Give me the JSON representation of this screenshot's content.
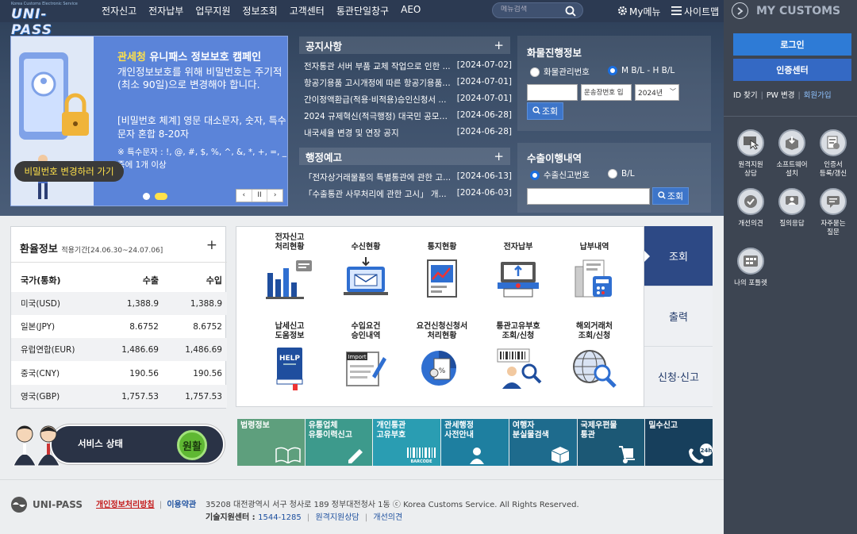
{
  "nav": {
    "logo_tiny": "Korea Customs Electronic Service",
    "logo": "UNI-PASS",
    "menus": [
      "전자신고",
      "전자납부",
      "업무지원",
      "정보조회",
      "고객센터",
      "통관단일창구",
      "AEO"
    ],
    "search_placeholder": "메뉴검색",
    "mymenu": "My메뉴",
    "sitemap": "사이트맵"
  },
  "banner": {
    "title_accent": "관세청",
    "title_main": "유니패스 정보보호 캠페인",
    "line1": "개인정보보호를 위해 비밀번호는 주기적(최소 90일)으로 변경해야 합니다.",
    "line2": "[비밀번호 체계] 영문 대소문자, 숫자, 특수문자 혼합 8-20자",
    "line3": "※ 특수문자 : !, @, #, $, %, ^, &, *, +, =, _ 중에 1개 이상",
    "button": "비밀번호 변경하러 가기",
    "controls": [
      "‹",
      "II",
      "›"
    ]
  },
  "notices": {
    "title": "공지사항",
    "plus": "+",
    "items": [
      {
        "text": "전자통관 서버 부품 교체 작업으로 인한 ...",
        "date": "[2024-07-02]"
      },
      {
        "text": "항공기용품 고시개정에 따른 항공기용품(...",
        "date": "[2024-07-01]"
      },
      {
        "text": "간이정액환급(적용·비적용)승인신청서 ...",
        "date": "[2024-07-01]"
      },
      {
        "text": "2024 규제혁신(적극행정) 대국민 공모전...",
        "date": "[2024-06-28]"
      },
      {
        "text": "내국세율 변경 및 연장 공지",
        "date": "[2024-06-28]"
      }
    ]
  },
  "admin": {
    "title": "행정예고",
    "plus": "+",
    "items": [
      {
        "text": "「전자상거래물품의 특별통관에 관한 고...",
        "date": "[2024-06-13]"
      },
      {
        "text": "「수출통관 사무처리에 관한 고시」 개...",
        "date": "[2024-06-03]"
      }
    ]
  },
  "cargo": {
    "title": "화물진행정보",
    "radio1": "화물관리번호",
    "radio2": "M B/L - H B/L",
    "field2": "운송장번호 입",
    "year": "2024년",
    "search": "조회"
  },
  "export": {
    "title": "수출이행내역",
    "radio1": "수출신고번호",
    "radio2": "B/L",
    "search": "조회"
  },
  "rates": {
    "title": "환율정보",
    "period": "적용기간[24.06.30~24.07.06]",
    "plus": "+",
    "headers": [
      "국가(통화)",
      "수출",
      "수입"
    ],
    "rows": [
      [
        "미국(USD)",
        "1,388.9",
        "1,388.9"
      ],
      [
        "일본(JPY)",
        "8.6752",
        "8.6752"
      ],
      [
        "유럽연합(EUR)",
        "1,486.69",
        "1,486.69"
      ],
      [
        "중국(CNY)",
        "190.56",
        "190.56"
      ],
      [
        "영국(GBP)",
        "1,757.53",
        "1,757.53"
      ]
    ]
  },
  "services": [
    "전자신고\n처리현황",
    "수신현황",
    "통지현황",
    "전자납부",
    "납부내역",
    "납세신고\n도움정보",
    "수입요건\n승인내역",
    "요건신청신청서\n처리현황",
    "통관고유부호\n조회/신청",
    "해외거래처\n조회/신청"
  ],
  "tabs": [
    "조회",
    "출력",
    "신청·신고"
  ],
  "status": {
    "label": "서비스 상태",
    "value": "원활"
  },
  "quick": [
    {
      "label": "법령정보",
      "color": "#5e9f7d"
    },
    {
      "label": "유통업체\n유통이력신고",
      "color": "#3d9a8c"
    },
    {
      "label": "개인통관\n고유부호",
      "color": "#2a9db2"
    },
    {
      "label": "관세행정\n사전안내",
      "color": "#1e7fa0"
    },
    {
      "label": "여행자\n분실물검색",
      "color": "#1e6b8d"
    },
    {
      "label": "국제우편물\n통관",
      "color": "#1c5875"
    },
    {
      "label": "밀수신고",
      "color": "#173f5c"
    }
  ],
  "footer": {
    "logo": "UNI-PASS",
    "privacy": "개인정보처리방침",
    "terms": "이용약관",
    "address": "35208 대전광역시 서구 청사로 189 정부대전청사 1동 ⓒ Korea Customs Service. All Rights Reserved.",
    "tech_label": "기술지원센터 : ",
    "tech_phone": "1544-1285",
    "remote": "원격지원상담",
    "feedback": "개선의견"
  },
  "side": {
    "title": "MY CUSTOMS",
    "login": "로그인",
    "cert": "인증센터",
    "id": "ID 찾기",
    "pw": "PW 변경",
    "join": "회원가입",
    "icons": [
      "원격지원\n상담",
      "소프트웨어\n설치",
      "인증서\n등록/갱신",
      "개선의견",
      "질의응답",
      "자주묻는\n질문",
      "나의 포틀렛"
    ]
  },
  "colors": {
    "accent": "#3d75c9",
    "navy": "#2d4985",
    "side": "#3d4552",
    "login": "#2e7bd6",
    "cert": "#3469c4"
  }
}
